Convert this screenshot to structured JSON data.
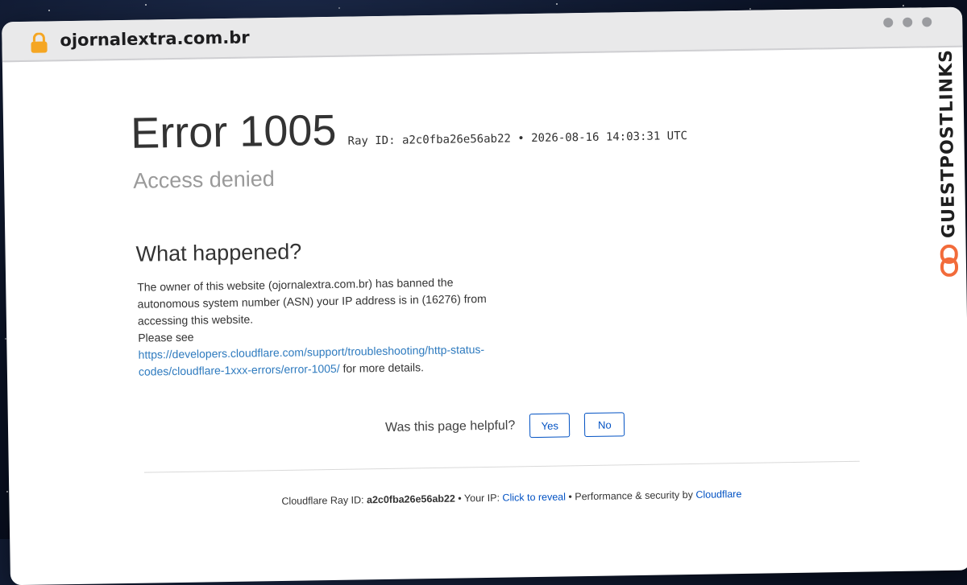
{
  "browser": {
    "url": "ojornalextra.com.br"
  },
  "error": {
    "title": "Error 1005",
    "ray_id_label": "Ray ID: a2c0fba26e56ab22",
    "separator": "•",
    "timestamp": "2026-08-16 14:03:31 UTC",
    "subtitle": "Access denied"
  },
  "what_happened": {
    "heading": "What happened?",
    "paragraph": "The owner of this website (ojornalextra.com.br) has banned the autonomous system number (ASN) your IP address is in (16276) from accessing this website.",
    "please_see": "Please see",
    "link": "https://developers.cloudflare.com/support/troubleshooting/http-status-codes/cloudflare-1xxx-errors/error-1005/",
    "after_link": "for more details."
  },
  "feedback": {
    "question": "Was this page helpful?",
    "yes": "Yes",
    "no": "No"
  },
  "footer": {
    "ray_label": "Cloudflare Ray ID:",
    "ray_id": "a2c0fba26e56ab22",
    "bullet": "•",
    "ip_label": "Your IP:",
    "reveal": "Click to reveal",
    "perf": "Performance & security by",
    "cloudflare": "Cloudflare"
  },
  "watermark": {
    "text": "GUESTPOSTLINKS",
    "accent": "#f26b3a"
  },
  "colors": {
    "link": "#2f7bbf",
    "button": "#0051c3",
    "lock": "#f5a623"
  }
}
